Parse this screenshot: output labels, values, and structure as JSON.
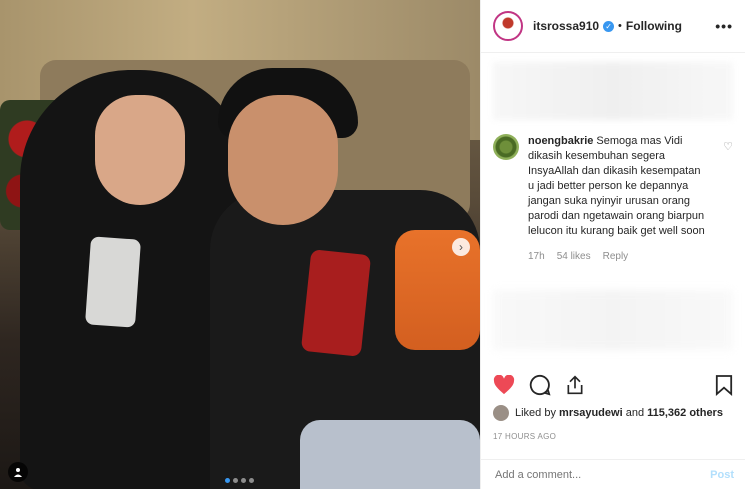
{
  "header": {
    "username": "itsrossa910",
    "separator": "•",
    "follow_status": "Following",
    "more": "•••"
  },
  "comment": {
    "username": "noengbakrie",
    "text": "Semoga mas Vidi dikasih kesembuhan segera InsyaAllah dan dikasih kesempatan u jadi better person ke depannya jangan suka nyinyir urusan orang parodi dan ngetawain orang biarpun lelucon itu kurang baik get well soon",
    "time": "17h",
    "likes": "54 likes",
    "reply": "Reply"
  },
  "likes": {
    "prefix": "Liked by",
    "user": "mrsayudewi",
    "and": "and",
    "count": "115,362 others"
  },
  "timestamp": "17 HOURS AGO",
  "add_comment": {
    "placeholder": "Add a comment...",
    "post_label": "Post"
  },
  "carousel": {
    "slides": 4,
    "active": 1
  },
  "colors": {
    "heart": "#ed4956",
    "accent": "#3897f0",
    "post_disabled": "#b2dffc"
  },
  "icons": [
    "heart-icon",
    "comment-icon",
    "share-icon",
    "bookmark-icon",
    "chevron-right-icon",
    "tag-user-icon",
    "verified-icon"
  ]
}
